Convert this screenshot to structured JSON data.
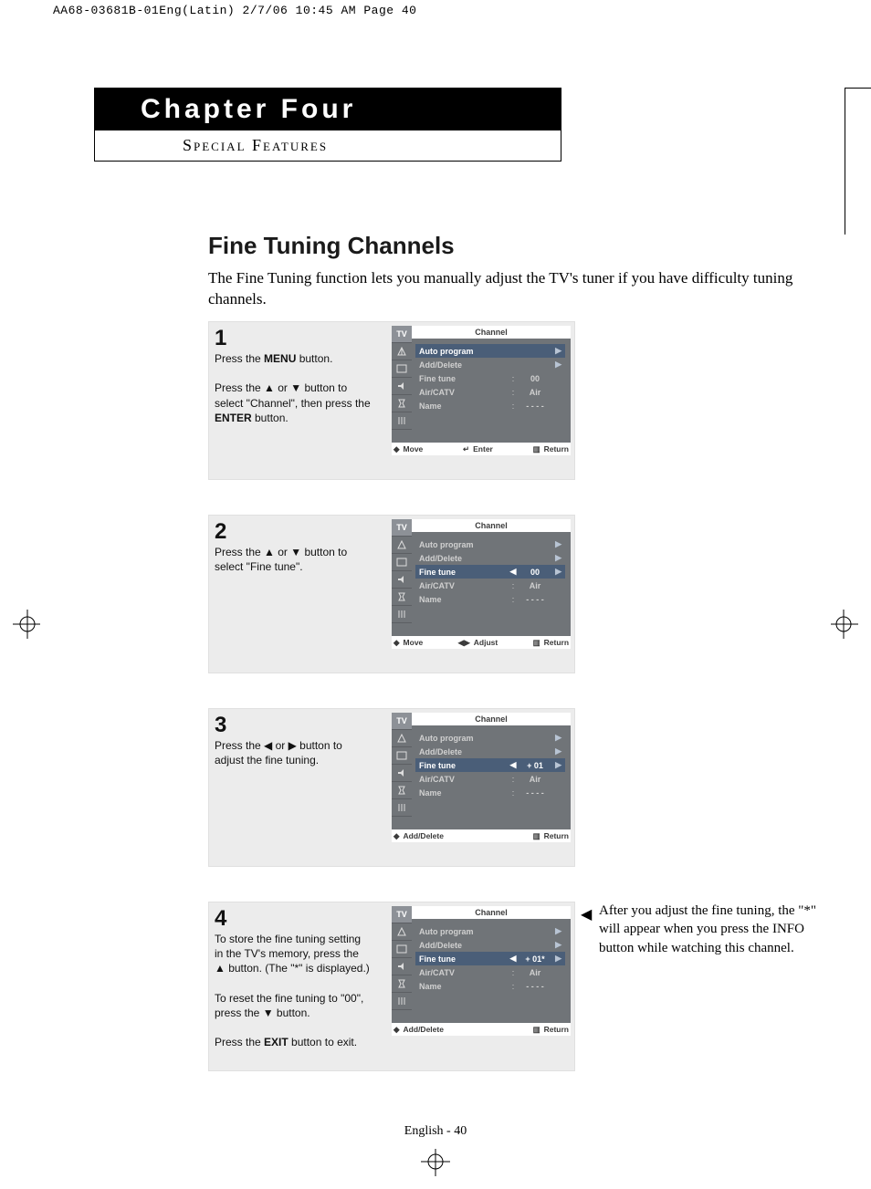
{
  "header_strip": "AA68-03681B-01Eng(Latin)  2/7/06  10:45 AM  Page 40",
  "chapter": {
    "title": "Chapter Four",
    "subtitle": "Special Features"
  },
  "section_title": "Fine Tuning Channels",
  "intro": "The Fine Tuning function lets you manually adjust the TV's tuner if you have difficulty tuning channels.",
  "steps": {
    "1": {
      "num": "1",
      "p1a": "Press the ",
      "p1b": "MENU",
      "p1c": " button.",
      "p2a": "Press the ▲ or ▼ button to select \"Channel\", then press the ",
      "p2b": "ENTER",
      "p2c": " button."
    },
    "2": {
      "num": "2",
      "p1": "Press the ▲ or ▼ button to select \"Fine tune\"."
    },
    "3": {
      "num": "3",
      "p1": "Press the ◀ or ▶ button to adjust the fine tuning."
    },
    "4": {
      "num": "4",
      "p1": "To store the fine tuning setting in the TV's memory, press the ▲ button. (The \"*\" is displayed.)",
      "p2": "To reset the fine tuning to \"00\", press the ▼ button.",
      "p3a": "Press the ",
      "p3b": "EXIT",
      "p3c": " button to exit."
    }
  },
  "osd": {
    "tv_tab": "TV",
    "title": "Channel",
    "rows": {
      "auto": "Auto program",
      "add": "Add/Delete",
      "fine": "Fine tune",
      "air": "Air/CATV",
      "name": "Name",
      "air_val": "Air",
      "name_val": "- - - -",
      "val_00": "00",
      "val_01": "+ 01",
      "val_01s": "+ 01*"
    },
    "foot": {
      "move": "Move",
      "enter": "Enter",
      "return": "Return",
      "adjust": "Adjust",
      "adddelete": "Add/Delete"
    }
  },
  "side_note": "After you adjust the fine tuning, the \"*\" will appear when you press the INFO button while watching this channel.",
  "page_foot": "English - 40"
}
